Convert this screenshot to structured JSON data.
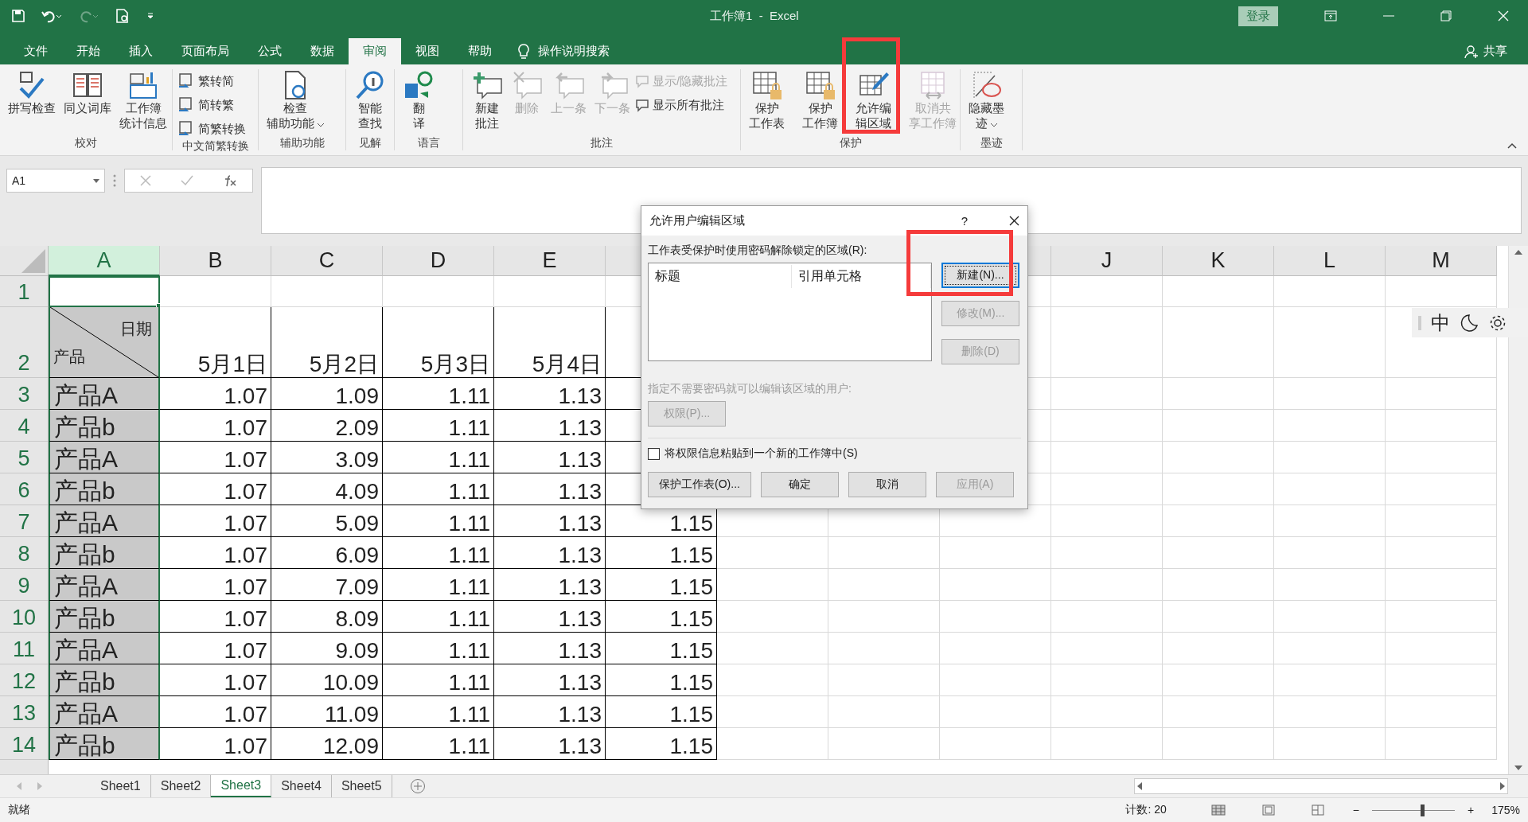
{
  "window": {
    "title": "工作簿1  -  Excel",
    "login": "登录",
    "share": "共享"
  },
  "tabs": [
    {
      "label": "文件",
      "selected": false
    },
    {
      "label": "开始",
      "selected": false
    },
    {
      "label": "插入",
      "selected": false
    },
    {
      "label": "页面布局",
      "selected": false
    },
    {
      "label": "公式",
      "selected": false
    },
    {
      "label": "数据",
      "selected": false
    },
    {
      "label": "审阅",
      "selected": true
    },
    {
      "label": "视图",
      "selected": false
    },
    {
      "label": "帮助",
      "selected": false
    }
  ],
  "tell_me": "操作说明搜索",
  "ribbon": {
    "groups": [
      {
        "label": "校对",
        "items": [
          {
            "kind": "large",
            "lines": [
              "拼写检查"
            ],
            "disabled": false,
            "dropdown": false
          },
          {
            "kind": "large",
            "lines": [
              "同义词库"
            ],
            "disabled": false,
            "dropdown": false
          },
          {
            "kind": "large",
            "lines": [
              "工作簿",
              "统计信息"
            ],
            "disabled": false,
            "dropdown": false
          }
        ]
      },
      {
        "label": "中文简繁转换",
        "items": [
          {
            "kind": "small",
            "lines": [
              "繁转简"
            ],
            "disabled": false,
            "dropdown": false
          },
          {
            "kind": "small",
            "lines": [
              "简转繁"
            ],
            "disabled": false,
            "dropdown": false
          },
          {
            "kind": "small",
            "lines": [
              "简繁转换"
            ],
            "disabled": false,
            "dropdown": false
          }
        ]
      },
      {
        "label": "辅助功能",
        "items": [
          {
            "kind": "large",
            "lines": [
              "检查",
              "辅助功能"
            ],
            "disabled": false,
            "dropdown": true
          }
        ]
      },
      {
        "label": "见解",
        "items": [
          {
            "kind": "large",
            "lines": [
              "智能",
              "查找"
            ],
            "disabled": false,
            "dropdown": false
          }
        ]
      },
      {
        "label": "语言",
        "items": [
          {
            "kind": "large",
            "lines": [
              "翻",
              "译"
            ],
            "disabled": false,
            "dropdown": false
          }
        ]
      },
      {
        "label": "批注",
        "items": [
          {
            "kind": "large",
            "lines": [
              "新建",
              "批注"
            ],
            "disabled": false,
            "dropdown": false
          },
          {
            "kind": "large",
            "lines": [
              "删除"
            ],
            "disabled": true,
            "dropdown": false
          },
          {
            "kind": "large",
            "lines": [
              "上一条"
            ],
            "disabled": true,
            "dropdown": false
          },
          {
            "kind": "large",
            "lines": [
              "下一条"
            ],
            "disabled": true,
            "dropdown": false
          },
          {
            "kind": "small",
            "lines": [
              "显示/隐藏批注"
            ],
            "disabled": true,
            "dropdown": false
          },
          {
            "kind": "small",
            "lines": [
              "显示所有批注"
            ],
            "disabled": false,
            "dropdown": false
          }
        ]
      },
      {
        "label": "保护",
        "items": [
          {
            "kind": "large",
            "lines": [
              "保护",
              "工作表"
            ],
            "disabled": false,
            "dropdown": false
          },
          {
            "kind": "large",
            "lines": [
              "保护",
              "工作簿"
            ],
            "disabled": false,
            "dropdown": false
          },
          {
            "kind": "large",
            "lines": [
              "允许编",
              "辑区域"
            ],
            "disabled": false,
            "dropdown": false
          },
          {
            "kind": "large",
            "lines": [
              "取消共",
              "享工作簿"
            ],
            "disabled": true,
            "dropdown": false
          }
        ]
      },
      {
        "label": "墨迹",
        "items": [
          {
            "kind": "large",
            "lines": [
              "隐藏墨",
              "迹"
            ],
            "disabled": false,
            "dropdown": true
          }
        ]
      }
    ]
  },
  "formula_bar": {
    "name_box": "A1"
  },
  "columns_left": [
    {
      "label": "A",
      "selected": true
    },
    {
      "label": "B",
      "selected": false
    },
    {
      "label": "C",
      "selected": false
    },
    {
      "label": "D",
      "selected": false
    },
    {
      "label": "E",
      "selected": false
    }
  ],
  "columns_right": [
    {
      "label": "J",
      "selected": false
    },
    {
      "label": "K",
      "selected": false
    },
    {
      "label": "L",
      "selected": false
    },
    {
      "label": "M",
      "selected": false
    }
  ],
  "rows": [
    {
      "number": "1",
      "kind": "blank"
    },
    {
      "number": "2",
      "kind": "header",
      "corner_top": "日期",
      "corner_bottom": "产品",
      "cells": [
        "5月1日",
        "5月2日",
        "5月3日",
        "5月4日"
      ]
    },
    {
      "number": "3",
      "kind": "data",
      "cells": [
        "产品A",
        "1.07",
        "1.09",
        "1.11",
        "1.13"
      ]
    },
    {
      "number": "4",
      "kind": "data",
      "cells": [
        "产品b",
        "1.07",
        "2.09",
        "1.11",
        "1.13"
      ]
    },
    {
      "number": "5",
      "kind": "data",
      "cells": [
        "产品A",
        "1.07",
        "3.09",
        "1.11",
        "1.13"
      ]
    },
    {
      "number": "6",
      "kind": "data",
      "cells": [
        "产品b",
        "1.07",
        "4.09",
        "1.11",
        "1.13"
      ]
    },
    {
      "number": "7",
      "kind": "data",
      "cells": [
        "产品A",
        "1.07",
        "5.09",
        "1.11",
        "1.13",
        "1.15"
      ]
    },
    {
      "number": "8",
      "kind": "data",
      "cells": [
        "产品b",
        "1.07",
        "6.09",
        "1.11",
        "1.13",
        "1.15"
      ]
    },
    {
      "number": "9",
      "kind": "data",
      "cells": [
        "产品A",
        "1.07",
        "7.09",
        "1.11",
        "1.13",
        "1.15"
      ]
    },
    {
      "number": "10",
      "kind": "data",
      "cells": [
        "产品b",
        "1.07",
        "8.09",
        "1.11",
        "1.13",
        "1.15"
      ]
    },
    {
      "number": "11",
      "kind": "data",
      "cells": [
        "产品A",
        "1.07",
        "9.09",
        "1.11",
        "1.13",
        "1.15"
      ]
    },
    {
      "number": "12",
      "kind": "data",
      "cells": [
        "产品b",
        "1.07",
        "10.09",
        "1.11",
        "1.13",
        "1.15"
      ]
    },
    {
      "number": "13",
      "kind": "data",
      "cells": [
        "产品A",
        "1.07",
        "11.09",
        "1.11",
        "1.13",
        "1.15"
      ]
    },
    {
      "number": "14",
      "kind": "data",
      "cells": [
        "产品b",
        "1.07",
        "12.09",
        "1.11",
        "1.13",
        "1.15"
      ]
    }
  ],
  "sheets": [
    {
      "label": "Sheet1",
      "selected": false
    },
    {
      "label": "Sheet2",
      "selected": false
    },
    {
      "label": "Sheet3",
      "selected": true
    },
    {
      "label": "Sheet4",
      "selected": false
    },
    {
      "label": "Sheet5",
      "selected": false
    }
  ],
  "status": {
    "text": "就绪",
    "count": "计数: 20",
    "zoom": "175%",
    "zoom_out": "−",
    "zoom_in": "+",
    "zoom_slider": {
      "level": 0.63
    }
  },
  "ime_toolbar": {
    "mode": "中"
  },
  "dialog": {
    "title": "允许用户编辑区域",
    "help": "?",
    "ranges_label": "工作表受保护时使用密码解除锁定的区域(R):",
    "list_columns": [
      "标题",
      "引用单元格"
    ],
    "side_buttons": [
      {
        "label": "新建(N)...",
        "disabled": false,
        "focused": true
      },
      {
        "label": "修改(M)...",
        "disabled": true,
        "focused": false
      },
      {
        "label": "删除(D)",
        "disabled": true,
        "focused": false
      }
    ],
    "users_label": {
      "text": "指定不需要密码就可以编辑该区域的用户:",
      "disabled": true
    },
    "permissions_button": {
      "label": "权限(P)...",
      "disabled": true
    },
    "checkbox": {
      "label": "将权限信息粘贴到一个新的工作簿中(S)",
      "checked": false
    },
    "buttons": [
      {
        "label": "保护工作表(O)...",
        "disabled": false
      },
      {
        "label": "确定",
        "disabled": false
      },
      {
        "label": "取消",
        "disabled": false
      },
      {
        "label": "应用(A)",
        "disabled": true
      }
    ]
  }
}
